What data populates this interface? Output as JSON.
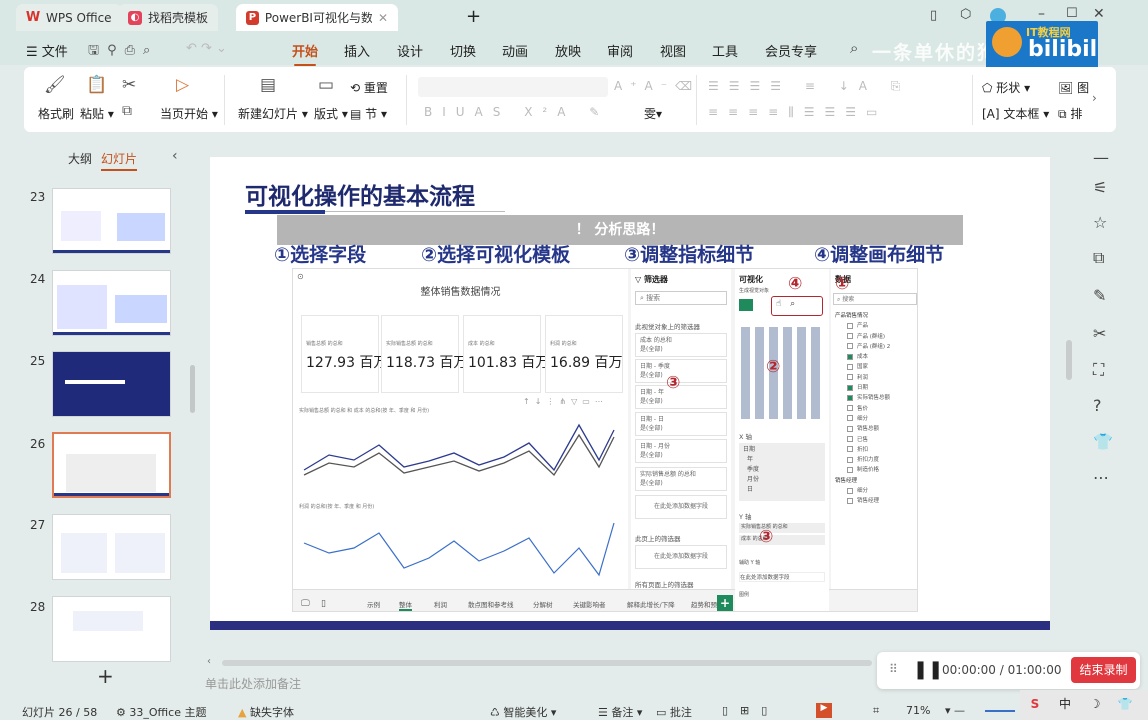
{
  "window": {
    "tabs": [
      {
        "label": "WPS Office",
        "icon": "wps-logo"
      },
      {
        "label": "找稻壳模板",
        "icon": "docer-logo"
      },
      {
        "label": "PowerBI可视化与数据分析-张",
        "icon": "ppt-logo"
      }
    ],
    "new_tab": "+"
  },
  "menu": {
    "file": "文件",
    "items": [
      "开始",
      "插入",
      "设计",
      "切换",
      "动画",
      "放映",
      "审阅",
      "视图",
      "工具",
      "会员专享"
    ],
    "active": "开始"
  },
  "watermark": "一条单休的狗",
  "bili": {
    "text1": "IT教程网",
    "text2": "bilibili"
  },
  "ribbon": {
    "format_painter": "格式刷",
    "paste": "粘贴",
    "play_current": "当页开始",
    "new_slide": "新建幻灯片",
    "layout": "版式",
    "reset": "重置",
    "section": "节",
    "shape": "形状",
    "textbox": "文本框",
    "picture": "图",
    "arrange": "排"
  },
  "left_panel": {
    "tab_outline": "大纲",
    "tab_slides": "幻灯片",
    "slides": [
      "23",
      "24",
      "25",
      "26",
      "27",
      "28"
    ],
    "selected": "26",
    "add": "+"
  },
  "slide": {
    "title": "可视化操作的基本流程",
    "banner": "！ 分析思路！",
    "steps": [
      "①选择字段",
      "②选择可视化模板",
      "③调整指标细节",
      "④调整画布细节"
    ],
    "pbi": {
      "report_title": "整体销售数据情况",
      "cards": [
        {
          "label": "销售总额 的总和",
          "value": "127.93 百万"
        },
        {
          "label": "实际销售总额 的总和",
          "value": "118.73 百万"
        },
        {
          "label": "成本 的总和",
          "value": "101.83 百万"
        },
        {
          "label": "利润 的总和",
          "value": "16.89 百万"
        }
      ],
      "chart1_title": "实际销售总额 的总和 和 成本 的总和(按 年、季度 和 月份)",
      "chart2_title": "利润 的总和(按 年、季度 和 月份)",
      "page_tabs": [
        "示例",
        "整体",
        "利润",
        "散点图和参考线",
        "分解树",
        "关键影响者",
        "解释此增长/下降",
        "趋势和预"
      ],
      "active_page": "整体",
      "filters": {
        "title": "筛选器",
        "search": "搜索",
        "on_visual": "此视觉对象上的筛选器",
        "items": [
          {
            "name": "成本 的总和",
            "state": "是(全部)"
          },
          {
            "name": "日期 - 季度",
            "state": "是(全部)"
          },
          {
            "name": "日期 - 年",
            "state": "是(全部)"
          },
          {
            "name": "日期 - 日",
            "state": "是(全部)"
          },
          {
            "name": "日期 - 月份",
            "state": "是(全部)"
          },
          {
            "name": "实际销售总额 的总和",
            "state": "是(全部)"
          }
        ],
        "add_field": "在此处添加数据字段",
        "on_page": "此页上的筛选器",
        "all_pages": "所有页面上的筛选器"
      },
      "viz": {
        "title": "可视化",
        "subtitle": "生成视觉对象",
        "x_axis": "X 轴",
        "x_fields": [
          "日期",
          "年",
          "季度",
          "月份",
          "日"
        ],
        "y_axis": "Y 轴",
        "y_fields": [
          "实际销售总额 的总和",
          "成本 的总和"
        ],
        "secondary_y": "辅助 Y 轴",
        "add_field": "在此处添加数据字段",
        "legend": "图例"
      },
      "data": {
        "title": "数据",
        "search": "搜索",
        "tables": [
          {
            "name": "产品销售情况",
            "fields": [
              {
                "name": "产品",
                "checked": false
              },
              {
                "name": "产品 (群组)",
                "checked": false
              },
              {
                "name": "产品 (群组) 2",
                "checked": false
              },
              {
                "name": "成本",
                "checked": true
              },
              {
                "name": "国家",
                "checked": false
              },
              {
                "name": "利润",
                "checked": false
              },
              {
                "name": "日期",
                "checked": true
              },
              {
                "name": "实际销售总额",
                "checked": true
              },
              {
                "name": "售价",
                "checked": false
              },
              {
                "name": "细分",
                "checked": false
              },
              {
                "name": "销售总额",
                "checked": false
              },
              {
                "name": "已售",
                "checked": false
              },
              {
                "name": "折扣",
                "checked": false
              },
              {
                "name": "折扣力度",
                "checked": false
              },
              {
                "name": "制造价格",
                "checked": false
              }
            ]
          },
          {
            "name": "销售经理",
            "fields": [
              {
                "name": "细分",
                "checked": false
              },
              {
                "name": "销售经理",
                "checked": false
              }
            ]
          }
        ]
      },
      "markers": [
        "①",
        "②",
        "③",
        "③",
        "④"
      ]
    }
  },
  "notes_placeholder": "单击此处添加备注",
  "recording": {
    "time": "00:00:00 / 01:00:00",
    "stop": "结束录制"
  },
  "status": {
    "slide_info": "幻灯片 26 / 58",
    "theme": "33_Office 主题",
    "missing_font": "缺失字体",
    "beautify": "智能美化",
    "notes": "备注",
    "comments": "批注",
    "zoom": "71%"
  },
  "ime": [
    "S",
    "中",
    "☽",
    "👕"
  ],
  "colors": {
    "accent": "#c4501c",
    "slide_title": "#26378a",
    "marker": "#b3282f",
    "record": "#e0383e",
    "pbi_green": "#1f8a5b"
  }
}
